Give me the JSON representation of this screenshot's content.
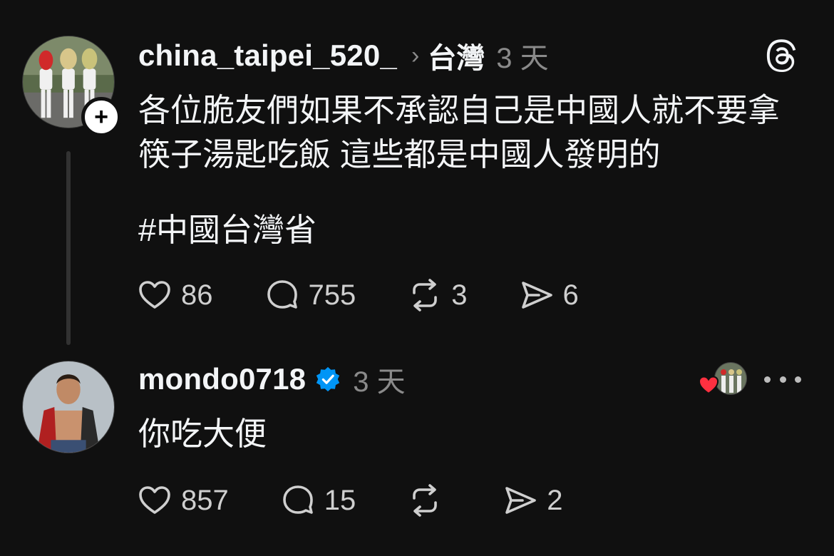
{
  "post": {
    "username": "china_taipei_520_",
    "chevron": "›",
    "topic": "台灣",
    "time": "3 天",
    "follow_symbol": "+",
    "text": "各位脆友們如果不承認自己是中國人就不要拿筷子湯匙吃飯 這些都是中國人發明的",
    "hashtag": "#中國台灣省",
    "actions": {
      "likes": "86",
      "replies": "755",
      "reposts": "3",
      "shares": "6"
    }
  },
  "reply": {
    "username": "mondo0718",
    "verified": true,
    "time": "3 天",
    "text": "你吃大便",
    "actions": {
      "likes": "857",
      "replies": "15",
      "reposts": "",
      "shares": "2"
    }
  },
  "icons": {
    "app_logo": "threads-logo-icon",
    "like": "heart-icon",
    "reply": "speech-bubble-icon",
    "repost": "repost-icon",
    "share": "send-icon",
    "more": "ellipsis-icon",
    "verified": "verified-badge-icon"
  },
  "colors": {
    "background": "#101010",
    "primary_text": "#f3f5f7",
    "secondary_text": "#8a8a8a",
    "verified_blue": "#0095f6",
    "heart_red": "#ff3040"
  }
}
